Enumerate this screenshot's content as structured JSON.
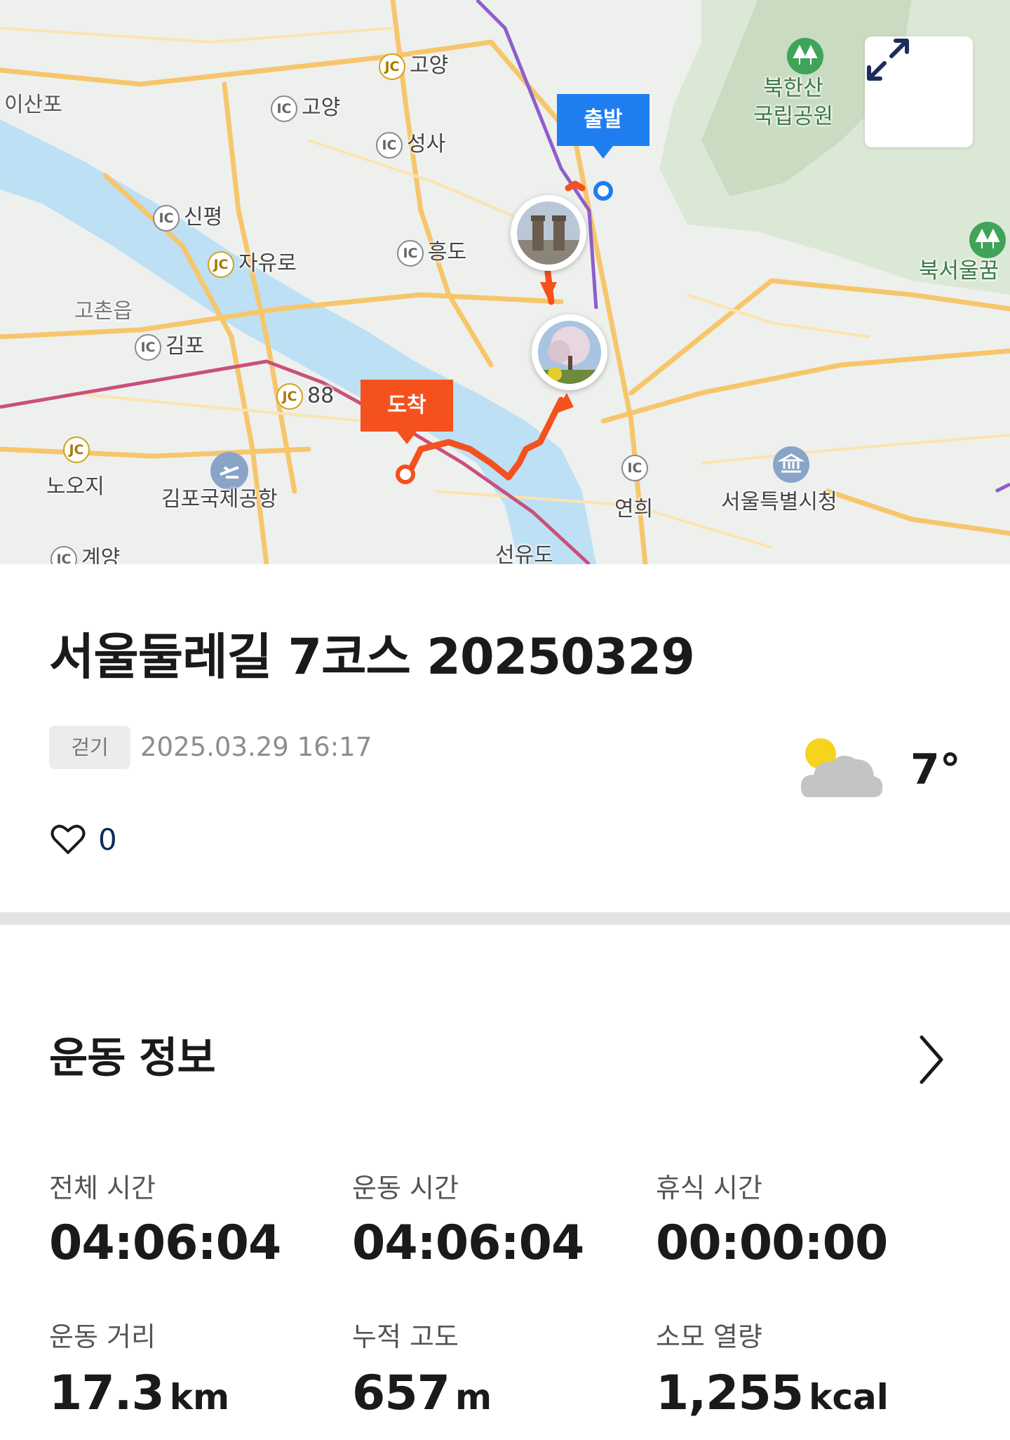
{
  "map": {
    "labels": {
      "isanpo": "이산포",
      "goyang_jc": "고양",
      "goyang_ic": "고양",
      "seongsa": "성사",
      "sinpyeong": "신평",
      "jayuro": "자유로",
      "heungdo": "흥도",
      "gochon": "고촌읍",
      "gimpo": "김포",
      "jc88": "88",
      "nooji": "노오지",
      "gimpo_airport": "김포국제공항",
      "gyeyang": "계양",
      "yeonhui": "연희",
      "seoul_city_hall": "서울특별시청",
      "seonyudo": "선유도",
      "bukhansan_line1": "북한산",
      "bukhansan_line2": "국립공원",
      "bukseoul": "북서울꿈"
    },
    "badges": {
      "ic": "IC",
      "jc": "JC"
    },
    "start_label": "출발",
    "end_label": "도착",
    "route_color": "#f4511e",
    "start_color": "#1e7ef0"
  },
  "record": {
    "title": "서울둘레길 7코스 20250329",
    "activity_type": "걷기",
    "datetime": "2025.03.29 16:17",
    "weather": {
      "icon": "partly-cloudy",
      "temperature": "7°"
    },
    "likes": "0"
  },
  "section": {
    "title": "운동 정보"
  },
  "stats": {
    "total_time": {
      "label": "전체 시간",
      "value": "04:06:04"
    },
    "moving_time": {
      "label": "운동 시간",
      "value": "04:06:04"
    },
    "rest_time": {
      "label": "휴식 시간",
      "value": "00:00:00"
    },
    "distance": {
      "label": "운동 거리",
      "value": "17.3",
      "unit": "km"
    },
    "elevation": {
      "label": "누적 고도",
      "value": "657",
      "unit": "m"
    },
    "calories": {
      "label": "소모 열량",
      "value": "1,255",
      "unit": "kcal"
    }
  }
}
